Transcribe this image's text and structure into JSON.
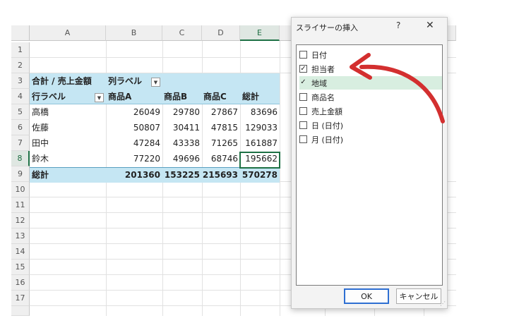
{
  "columns": [
    "A",
    "B",
    "C",
    "D",
    "E"
  ],
  "rows": [
    "1",
    "2",
    "3",
    "4",
    "5",
    "6",
    "7",
    "8",
    "9",
    "10",
    "11",
    "12",
    "13",
    "14",
    "15",
    "16",
    "17"
  ],
  "pivot": {
    "value_label": "合計 / 売上金額",
    "col_label": "列ラベル",
    "row_label": "行ラベル",
    "headers": [
      "商品A",
      "商品B",
      "商品C",
      "総計"
    ],
    "data": [
      {
        "name": "高橋",
        "values": [
          "26049",
          "29780",
          "27867",
          "83696"
        ]
      },
      {
        "name": "佐藤",
        "values": [
          "50807",
          "30411",
          "47815",
          "129033"
        ]
      },
      {
        "name": "田中",
        "values": [
          "47284",
          "43338",
          "71265",
          "161887"
        ]
      },
      {
        "name": "鈴木",
        "values": [
          "77220",
          "49696",
          "68746",
          "195662"
        ]
      }
    ],
    "total_label": "総計",
    "totals": [
      "201360",
      "153225",
      "215693",
      "570278"
    ]
  },
  "dialog": {
    "title": "スライサーの挿入",
    "help": "?",
    "close": "✕",
    "items": [
      {
        "label": "日付",
        "checked": false
      },
      {
        "label": "担当者",
        "checked": true
      },
      {
        "label": "地域",
        "checked": true,
        "highlight": true
      },
      {
        "label": "商品名",
        "checked": false
      },
      {
        "label": "売上金額",
        "checked": false
      },
      {
        "label": "日 (日付)",
        "checked": false
      },
      {
        "label": "月 (日付)",
        "checked": false
      }
    ],
    "ok": "OK",
    "cancel": "キャンセル"
  },
  "colors": {
    "accent_green": "#1e7145",
    "pivot_band": "#c5e6f3",
    "arrow": "#d32f2f"
  },
  "icons": [
    "dropdown-icon",
    "checkmark-icon",
    "close-icon",
    "help-icon",
    "resize-grip-icon",
    "red-arrow-annotation"
  ]
}
